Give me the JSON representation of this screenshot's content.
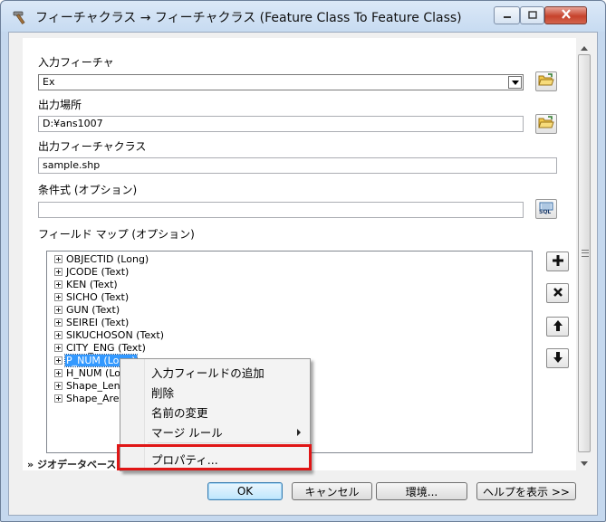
{
  "window": {
    "title": "フィーチャクラス → フィーチャクラス (Feature Class To Feature Class)"
  },
  "form": {
    "input_features": {
      "label": "入力フィーチャ",
      "value": "Ex"
    },
    "output_location": {
      "label": "出力場所",
      "value": "D:¥ans1007"
    },
    "output_feature_class": {
      "label": "出力フィーチャクラス",
      "value": "sample.shp"
    },
    "expression": {
      "label": "条件式 (オプション)",
      "value": ""
    },
    "field_map": {
      "label": "フィールド マップ (オプション)"
    }
  },
  "field_map": {
    "items": [
      {
        "label": "OBJECTID (Long)",
        "selected": false
      },
      {
        "label": "JCODE (Text)",
        "selected": false
      },
      {
        "label": "KEN (Text)",
        "selected": false
      },
      {
        "label": "SICHO (Text)",
        "selected": false
      },
      {
        "label": "GUN (Text)",
        "selected": false
      },
      {
        "label": "SEIREI (Text)",
        "selected": false
      },
      {
        "label": "SIKUCHOSON (Text)",
        "selected": false
      },
      {
        "label": "CITY_ENG (Text)",
        "selected": false
      },
      {
        "label": "P_NUM (Long)",
        "selected": true
      },
      {
        "label": "H_NUM (Lon",
        "selected": false
      },
      {
        "label": "Shape_Leng",
        "selected": false
      },
      {
        "label": "Shape_Area",
        "selected": false
      }
    ]
  },
  "context_menu": {
    "add_input_field": "入力フィールドの追加",
    "delete": "削除",
    "rename": "名前の変更",
    "merge_rule": "マージ ルール",
    "properties": "プロパティ..."
  },
  "geodatabase_section": {
    "label": "ジオデータベース"
  },
  "buttons": {
    "ok": "OK",
    "cancel": "キャンセル",
    "environments": "環境...",
    "show_help": "ヘルプを表示 >>"
  },
  "sql_button_label": "SQL",
  "colors": {
    "selection": "#3399ff",
    "highlight_box": "#e01616",
    "title_bar": "#c7dbf1"
  }
}
